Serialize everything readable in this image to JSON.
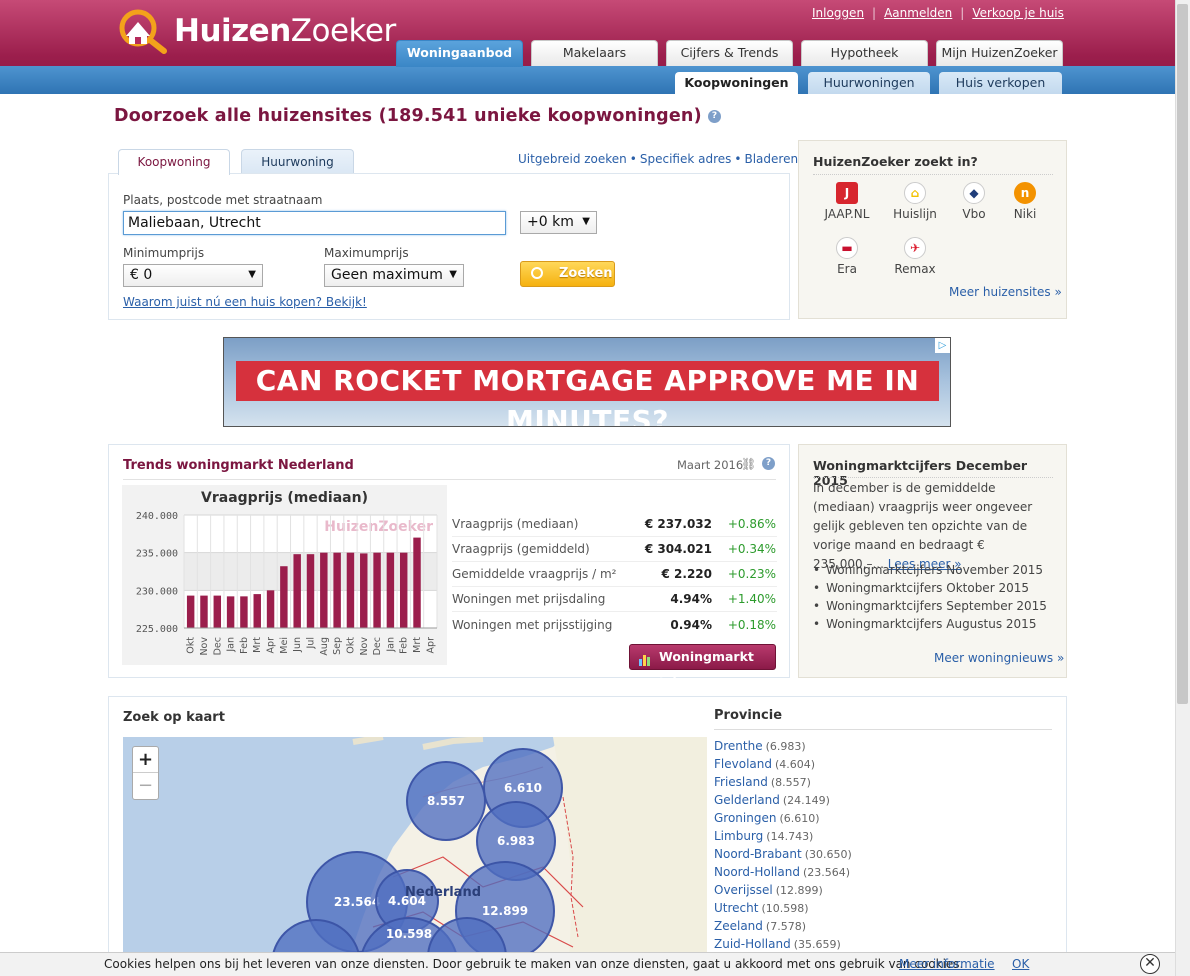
{
  "brand": {
    "name_bold": "Huizen",
    "name_light": "Zoeker"
  },
  "toplinks": [
    "Inloggen",
    "Aanmelden",
    "Verkoop je huis"
  ],
  "main_tabs": [
    "Woningaanbod",
    "Makelaars",
    "Cijfers & Trends",
    "Hypotheek",
    "Mijn HuizenZoeker"
  ],
  "sub_tabs": [
    "Koopwoningen",
    "Huurwoningen",
    "Huis verkopen"
  ],
  "page_title": "Doorzoek alle huizensites (189.541 unieke koopwoningen)",
  "search": {
    "tabs": [
      "Koopwoning",
      "Huurwoning"
    ],
    "links": [
      "Uitgebreid zoeken",
      "Specifiek adres",
      "Bladeren"
    ],
    "location_label": "Plaats, postcode met straatnaam",
    "location_value": "Maliebaan, Utrecht",
    "radius_value": "+0 km",
    "min_label": "Minimumprijs",
    "min_value": "€ 0",
    "max_label": "Maximumprijs",
    "max_value": "Geen maximum",
    "submit_label": "Zoeken",
    "promo_link": "Waarom juist nú een huis kopen? Bekijk!"
  },
  "sites_panel": {
    "title": "HuizenZoeker zoekt in?",
    "sites": [
      {
        "name": "JAAP.NL",
        "glyph": "J",
        "color": "#d7262e"
      },
      {
        "name": "Huislijn",
        "glyph": "⌂",
        "color": "#f2c200"
      },
      {
        "name": "Vbo",
        "glyph": "◆",
        "color": "#1f3d7a"
      },
      {
        "name": "Niki",
        "glyph": "n",
        "color": "#f39200"
      },
      {
        "name": "Era",
        "glyph": "▬",
        "color": "#c8102e"
      },
      {
        "name": "Remax",
        "glyph": "✈",
        "color": "#dc1c2e"
      }
    ],
    "more_link": "Meer huizensites »"
  },
  "ad": {
    "text": "CAN ROCKET MORTGAGE APPROVE ME IN MINUTES?"
  },
  "trends": {
    "title": "Trends woningmarkt Nederland",
    "date": "Maart 2016",
    "button": "Woningmarkt info",
    "stats": [
      {
        "label": "Vraagprijs (mediaan)",
        "value": "€ 237.032",
        "change": "+0.86%"
      },
      {
        "label": "Vraagprijs (gemiddeld)",
        "value": "€ 304.021",
        "change": "+0.34%"
      },
      {
        "label": "Gemiddelde vraagprijs / m²",
        "value": "€ 2.220",
        "change": "+0.23%"
      },
      {
        "label": "Woningen met prijsdaling",
        "value": "4.94%",
        "change": "+1.40%"
      },
      {
        "label": "Woningen met prijsstijging",
        "value": "0.94%",
        "change": "+0.18%"
      }
    ]
  },
  "chart_data": {
    "type": "bar",
    "title": "Vraagprijs (mediaan)",
    "categories": [
      "Okt",
      "Nov",
      "Dec",
      "Jan",
      "Feb",
      "Mrt",
      "Apr",
      "Mei",
      "Jun",
      "Jul",
      "Aug",
      "Sep",
      "Okt",
      "Nov",
      "Dec",
      "Jan",
      "Feb",
      "Mrt",
      "Apr"
    ],
    "values": [
      229.3,
      229.3,
      229.3,
      229.2,
      229.2,
      229.5,
      230.0,
      233.2,
      234.8,
      234.8,
      235.0,
      235.0,
      235.0,
      234.9,
      235.0,
      235.0,
      235.0,
      237.0,
      null
    ],
    "yticks": [
      "240.000",
      "235.000",
      "230.000",
      "225.000"
    ],
    "ylim": [
      225,
      240
    ],
    "bar_color": "#9b1e4c",
    "watermark": "HuizenZoeker"
  },
  "news": {
    "title": "Woningmarktcijfers December 2015",
    "body": "In december is de gemiddelde (mediaan) vraagprijs weer ongeveer gelijk gebleven ten opzichte van de vorige maand en bedraagt € 235,000,–...",
    "read_more": "Lees meer »",
    "items": [
      "Woningmarktcijfers November 2015",
      "Woningmarktcijfers Oktober 2015",
      "Woningmarktcijfers September 2015",
      "Woningmarktcijfers Augustus 2015"
    ],
    "more_link": "Meer woningnieuws »"
  },
  "map": {
    "title": "Zoek op kaart",
    "zoom_in": "+",
    "zoom_out": "−",
    "country_label": "Nederland",
    "clusters": [
      "8.557",
      "6.610",
      "6.983",
      "23.564",
      "4.604",
      "12.899",
      "10.598"
    ]
  },
  "provinces": {
    "title": "Provincie",
    "items": [
      {
        "name": "Drenthe",
        "count": "(6.983)"
      },
      {
        "name": "Flevoland",
        "count": "(4.604)"
      },
      {
        "name": "Friesland",
        "count": "(8.557)"
      },
      {
        "name": "Gelderland",
        "count": "(24.149)"
      },
      {
        "name": "Groningen",
        "count": "(6.610)"
      },
      {
        "name": "Limburg",
        "count": "(14.743)"
      },
      {
        "name": "Noord-Brabant",
        "count": "(30.650)"
      },
      {
        "name": "Noord-Holland",
        "count": "(23.564)"
      },
      {
        "name": "Overijssel",
        "count": "(12.899)"
      },
      {
        "name": "Utrecht",
        "count": "(10.598)"
      },
      {
        "name": "Zeeland",
        "count": "(7.578)"
      },
      {
        "name": "Zuid-Holland",
        "count": "(35.659)"
      }
    ]
  },
  "cookie": {
    "text": "Cookies helpen ons bij het leveren van onze diensten. Door gebruik te maken van onze diensten, gaat u akkoord met ons gebruik van cookies.",
    "info_link": "Meer informatie",
    "ok": "OK",
    "close": "✕"
  }
}
